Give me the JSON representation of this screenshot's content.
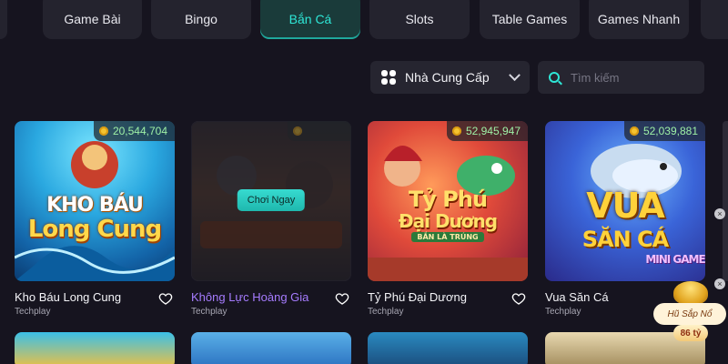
{
  "tabs": [
    {
      "label": "Game Bài",
      "active": false
    },
    {
      "label": "Bingo",
      "active": false
    },
    {
      "label": "Bắn Cá",
      "active": true
    },
    {
      "label": "Slots",
      "active": false
    },
    {
      "label": "Table Games",
      "active": false
    },
    {
      "label": "Games Nhanh",
      "active": false
    }
  ],
  "filter": {
    "provider_label": "Nhà Cung Cấp",
    "search_placeholder": "Tìm kiếm"
  },
  "games": [
    {
      "name": "Kho Báu Long Cung",
      "provider": "Techplay",
      "jackpot": "20,544,704",
      "art_line1": "KHO BÁU",
      "art_line2": "Long Cung",
      "hover": false
    },
    {
      "name": "Không Lực Hoàng Gia",
      "provider": "Techplay",
      "jackpot": "",
      "art_line1": "",
      "art_line2": "",
      "hover": true,
      "play_label": "Chơi Ngay"
    },
    {
      "name": "Tỷ Phú Đại Dương",
      "provider": "Techplay",
      "jackpot": "52,945,947",
      "art_line1": "Tỷ Phú",
      "art_line2": "Đại Dương",
      "art_line3": "BẮN LÀ TRÚNG",
      "hover": false
    },
    {
      "name": "Vua Săn Cá",
      "provider": "Techplay",
      "jackpot": "52,039,881",
      "art_line1": "VUA",
      "art_line2": "SĂN CÁ",
      "art_line3": "MINI GAME",
      "hover": false
    }
  ],
  "floating_jackpot": {
    "label": "Hũ Sắp Nổ",
    "value": "86 tỷ"
  },
  "colors": {
    "accent": "#2ee6d6",
    "background": "#16141f",
    "tab_bg": "#24232e",
    "jackpot_text": "#9ef0a6",
    "hover_name": "#a67cff"
  },
  "icons": [
    "grid-icon",
    "chevron-down-icon",
    "search-icon",
    "coin-icon",
    "heart-icon",
    "jackpot-pot-icon",
    "close-icon"
  ]
}
